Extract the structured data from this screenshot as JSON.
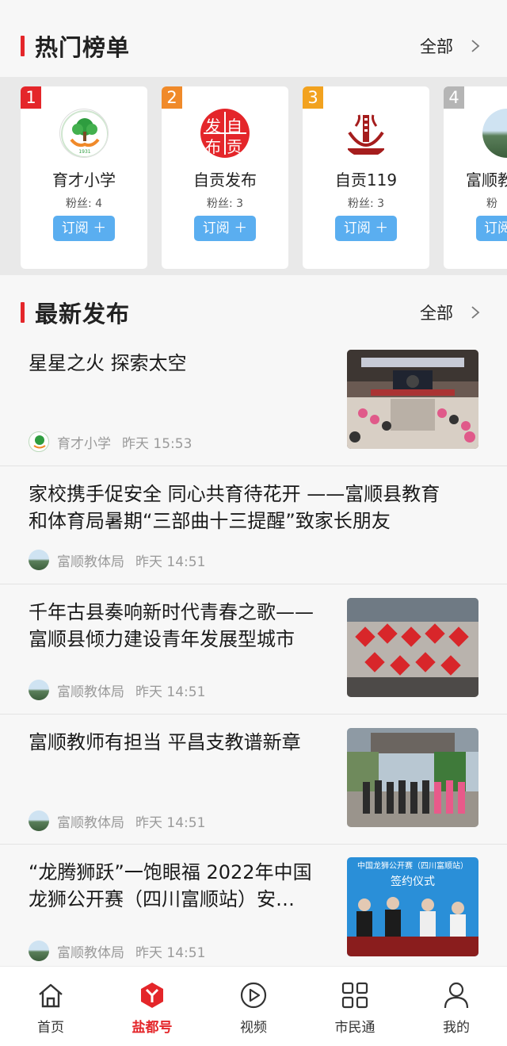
{
  "hot": {
    "title": "热门榜单",
    "all_label": "全部",
    "cards": [
      {
        "rank": "1",
        "rank_color": "#e4262a",
        "name": "育才小学",
        "fans": "粉丝: 4",
        "subscribe": "订阅 ＋",
        "logo": "tree-hands-logo"
      },
      {
        "rank": "2",
        "rank_color": "#f08a2a",
        "name": "自贡发布",
        "fans": "粉丝: 3",
        "subscribe": "订阅 ＋",
        "logo": "zigong-fabu-logo",
        "logo_text": [
          "发",
          "自",
          "布",
          "贡"
        ]
      },
      {
        "rank": "3",
        "rank_color": "#f2a21f",
        "name": "自贡119",
        "fans": "粉丝: 3",
        "subscribe": "订阅 ＋",
        "logo": "fire-119-logo"
      },
      {
        "rank": "4",
        "rank_color": "#b5b5b5",
        "name": "富顺教",
        "fans": "粉",
        "subscribe": "订阅",
        "logo": "landscape-logo"
      }
    ]
  },
  "latest": {
    "title": "最新发布",
    "all_label": "全部",
    "items": [
      {
        "title_lines": [
          "星星之火 探索太空"
        ],
        "source": "育才小学",
        "time": "昨天 15:53"
      },
      {
        "title_lines": [
          "家校携手促安全 同心共育待花开 ——富顺县教育",
          "和体育局暑期“三部曲十三提醒”致家长朋友"
        ],
        "source": "富顺教体局",
        "time": "昨天 14:51"
      },
      {
        "title_lines": [
          "千年古县奏响新时代青春之歌——",
          "富顺县倾力建设青年发展型城市"
        ],
        "source": "富顺教体局",
        "time": "昨天 14:51"
      },
      {
        "title_lines": [
          "富顺教师有担当 平昌支教谱新章"
        ],
        "source": "富顺教体局",
        "time": "昨天 14:51"
      },
      {
        "title_lines": [
          "“龙腾狮跃”一饱眼福 2022年中国",
          "龙狮公开赛（四川富顺站）安…"
        ],
        "source": "富顺教体局",
        "time": "昨天 14:51",
        "thumb_text": [
          "中国龙狮公开赛（四川富顺站）",
          "签约仪式"
        ]
      }
    ]
  },
  "tabbar": {
    "items": [
      {
        "label": "首页",
        "icon": "home-icon"
      },
      {
        "label": "盐都号",
        "icon": "yandu-hao-icon",
        "active": true
      },
      {
        "label": "视频",
        "icon": "play-icon"
      },
      {
        "label": "市民通",
        "icon": "grid-icon"
      },
      {
        "label": "我的",
        "icon": "user-icon"
      }
    ]
  },
  "colors": {
    "accent": "#e4262a",
    "subscribe": "#5aaef0"
  }
}
